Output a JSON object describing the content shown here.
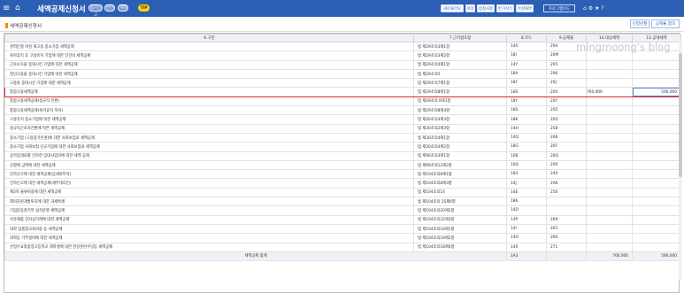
{
  "topbar": {
    "menu_icon": "≡",
    "home_icon": "⌂",
    "title": "세액공제신청서",
    "pills": [
      "정기신고",
      "연간",
      "개별",
      "TIP"
    ],
    "buttons": [
      "새로불러오기",
      "저장",
      "정정사항",
      "반기서식",
      "작성화면"
    ],
    "search_label": "프로그램이드",
    "icons": "⌂ ⚙ ★ ?"
  },
  "header": {
    "section_title": "세액공제신청서",
    "btn_apply": "신청년월",
    "btn_reference": "공제율 참조"
  },
  "table": {
    "columns": [
      "6.구분",
      "7.근거법조항",
      "8.코드",
      "9.공제율",
      "10.대상세액",
      "11.공제세액"
    ],
    "rows": [
      [
        "경력단절 여성 재고용 중소기업 세액공제",
        "법 제29조의3제1항",
        "14X",
        "294",
        "",
        ""
      ],
      [
        "육아휴직 후 고용유지 기업에 대한 인건비 세액공제",
        "법 제29조의3제2항",
        "18I",
        "20M",
        "",
        ""
      ],
      [
        "근로소득을 증대시킨 기업에 대한 세액공제",
        "법 제29조의4제1항",
        "14Y",
        "295",
        "",
        ""
      ],
      [
        "청년고용을 증대시킨 기업에 대한 세액공제",
        "법 제29조의5",
        "18A",
        "296",
        "",
        ""
      ],
      [
        "고용을 증대시킨 기업에 대한 세액공제",
        "법 제29조의7제1항",
        "18F",
        "20J",
        "",
        ""
      ],
      [
        "통합고용세액공제",
        "법 제29조의8제1항",
        "18S",
        "20X",
        "760,000",
        "590,000"
      ],
      [
        "통합고용세액공제(정규직 전환)",
        "법 제29조의 8제1항",
        "18Y",
        "20Y",
        "",
        ""
      ],
      [
        "통합고용세액공제(육아휴직 복귀)",
        "법 제29조의8제4항",
        "18S",
        "20Z",
        "",
        ""
      ],
      [
        "고용유지 중소기업에 대한 세액공제",
        "법 제30조의3제3항",
        "18K",
        "20O",
        "",
        ""
      ],
      [
        "정규직근로자전환에 따른 세액공제",
        "법 제30조의2제3항",
        "14H",
        "258",
        "",
        ""
      ],
      [
        "중소기업 (고용증가인원)에 대한 사회보험료 세액공제",
        "법 제30조의4제1항",
        "14Q",
        "268",
        "",
        ""
      ],
      [
        "중소기업 사회보험 신규가입에 대한 사회보험료 세액공제",
        "법 제30조의4제2항",
        "18G",
        "20F",
        "",
        ""
      ],
      [
        "상가임대료를 인하한 임대사업자에 대한 세액 공제",
        "법 제96조의3제1항",
        "10B",
        "20Q",
        "",
        ""
      ],
      [
        "선결제 금액에 대한 세액공제",
        "법 제99조의12제2항",
        "10Q",
        "20R",
        "",
        ""
      ],
      [
        "전자신고에 대한 세액공제(납세의무자)",
        "법 제104조의8제1항",
        "184",
        "244",
        "",
        ""
      ],
      [
        "전자신고에 대한 세액공제(세무대리인)",
        "법 제104조의8제3항",
        "14J",
        "2A6",
        "",
        ""
      ],
      [
        "제3자 물류비용에 대한 세액공제",
        "법 제104조의14",
        "14E",
        "256",
        "",
        ""
      ],
      [
        "해외자원개발투자에 대한 과세특례",
        "법 제104조의 15제6항",
        "186",
        "",
        "",
        ""
      ],
      [
        "기업운동경기부 설치운영 세액공제",
        "법 제104조의20제2항",
        "14D",
        "",
        "",
        ""
      ],
      [
        "석유제품 전자상거래에 대한 세액공제",
        "법 제104조의22제3항",
        "14P",
        "269",
        "",
        ""
      ],
      [
        "대학 맞춤형교육비용 등 세액공제",
        "법 제104조의18제1항",
        "14I",
        "265",
        "",
        ""
      ],
      [
        "대학등 기부설비에 대한 세액공제",
        "법 제104조의18제2항",
        "14O",
        "266",
        "",
        ""
      ],
      [
        "산업수요맞춤형고등학교 재학생에 대한 현장훈련수당등 세액공제",
        "법 제104조의18제4항",
        "14R",
        "271",
        "",
        ""
      ]
    ],
    "total": {
      "label": "세액공제 합계",
      "code": "1A3",
      "target": "760,000",
      "credit": "590,000"
    }
  },
  "watermark": "mingmoong's blog",
  "colors": {
    "topbar": "#2b5fb4",
    "highlight_border": "#d9262b",
    "accent": "#f28b00"
  }
}
